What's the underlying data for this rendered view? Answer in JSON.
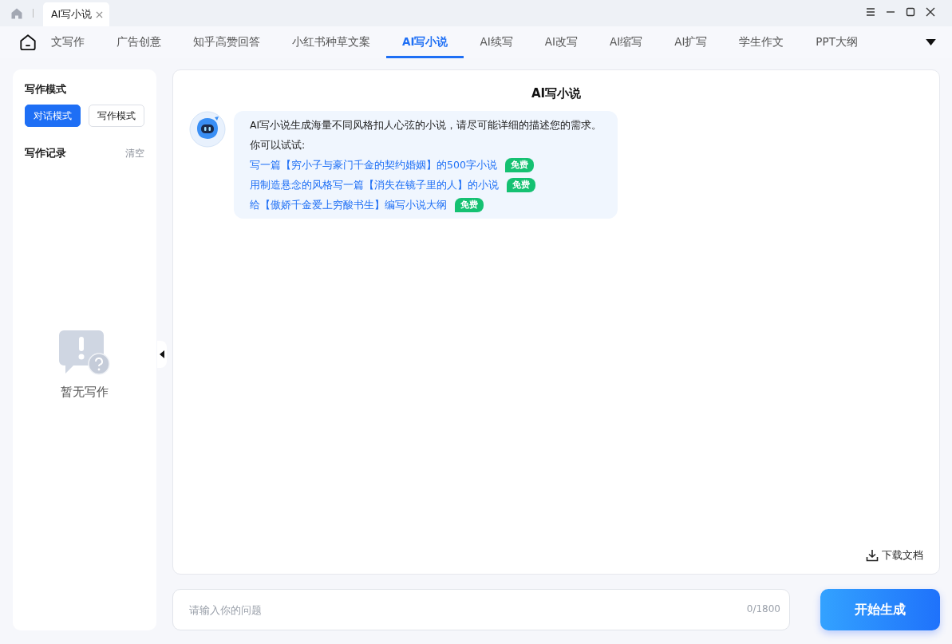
{
  "window": {
    "tab_title": "AI写小说"
  },
  "nav": {
    "items": [
      {
        "label": "文写作",
        "selected": false
      },
      {
        "label": "广告创意",
        "selected": false
      },
      {
        "label": "知乎高赞回答",
        "selected": false
      },
      {
        "label": "小红书种草文案",
        "selected": false
      },
      {
        "label": "AI写小说",
        "selected": true
      },
      {
        "label": "AI续写",
        "selected": false
      },
      {
        "label": "AI改写",
        "selected": false
      },
      {
        "label": "AI缩写",
        "selected": false
      },
      {
        "label": "AI扩写",
        "selected": false
      },
      {
        "label": "学生作文",
        "selected": false
      },
      {
        "label": "PPT大纲",
        "selected": false
      }
    ]
  },
  "sidebar": {
    "mode_title": "写作模式",
    "modes": [
      {
        "label": "对话模式",
        "selected": true
      },
      {
        "label": "写作模式",
        "selected": false
      }
    ],
    "history_title": "写作记录",
    "clear": "清空",
    "empty_text": "暂无写作"
  },
  "chat": {
    "title": "AI写小说",
    "intro": "AI写小说生成海量不同风格扣人心弦的小说，请尽可能详细的描述您的需求。",
    "try_label": "你可以试试:",
    "suggestions": [
      {
        "text": "写一篇【穷小子与豪门千金的契约婚姻】的500字小说",
        "badge": "免费"
      },
      {
        "text": "用制造悬念的风格写一篇【消失在镜子里的人】的小说",
        "badge": "免费"
      },
      {
        "text": "给【傲娇千金爱上穷酸书生】编写小说大纲",
        "badge": "免费"
      }
    ],
    "download": "下载文档"
  },
  "input": {
    "placeholder": "请输入你的问题",
    "counter": "0/1800",
    "submit": "开始生成"
  }
}
